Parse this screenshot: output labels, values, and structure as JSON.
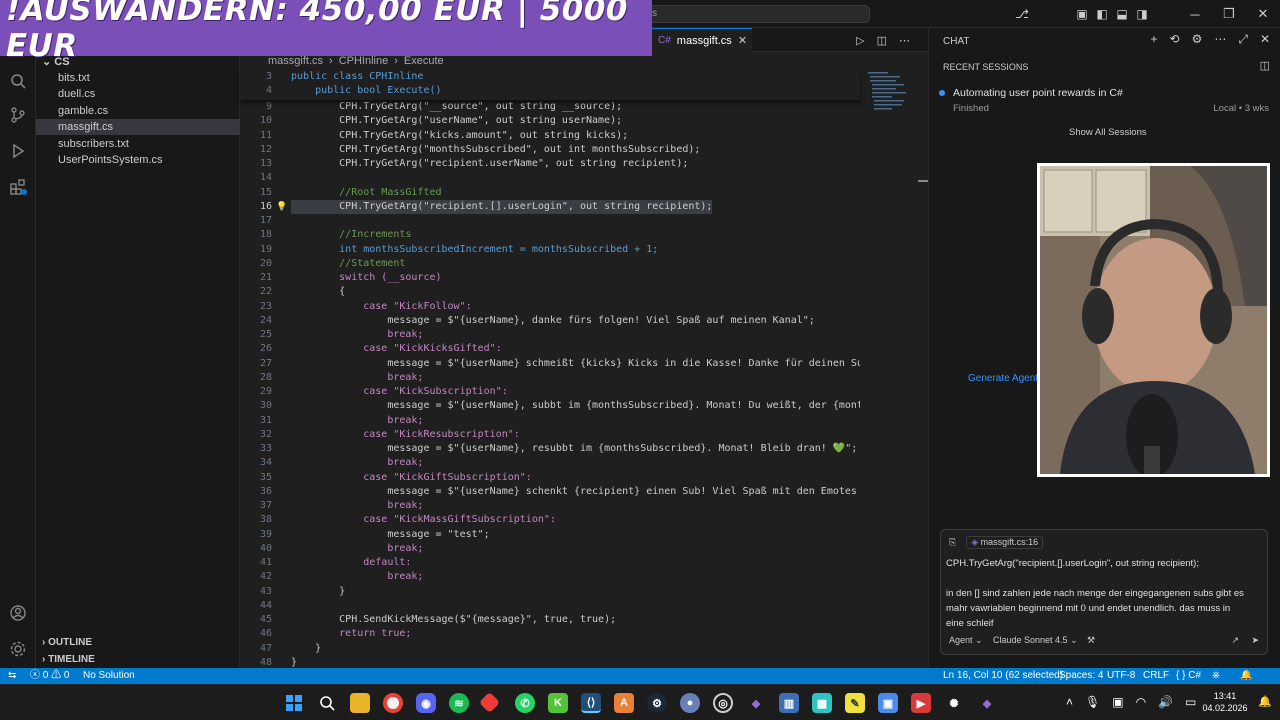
{
  "overlay_banner": "!AUSWANDERN: 450,00 EUR | 5000 EUR",
  "title_bar": {
    "search_text": "cs"
  },
  "explorer": {
    "folder": "CS",
    "files": [
      "bits.txt",
      "duell.cs",
      "gamble.cs",
      "massgift.cs",
      "subscribers.txt",
      "UserPointsSystem.cs"
    ],
    "active_file": "massgift.cs",
    "outline_label": "OUTLINE",
    "timeline_label": "TIMELINE"
  },
  "editor": {
    "tab_label": "massgift.cs",
    "breadcrumb": [
      "massgift.cs",
      "CPHInline",
      "Execute"
    ],
    "sticky_lines": [
      {
        "n": "3",
        "text": "public class CPHInline"
      },
      {
        "n": "4",
        "text": "    public bool Execute()"
      }
    ],
    "lines": [
      {
        "n": "9",
        "text": "        CPH.TryGetArg(\"__source\", out string __source);"
      },
      {
        "n": "10",
        "text": "        CPH.TryGetArg(\"userName\", out string userName);"
      },
      {
        "n": "11",
        "text": "        CPH.TryGetArg(\"kicks.amount\", out string kicks);"
      },
      {
        "n": "12",
        "text": "        CPH.TryGetArg(\"monthsSubscribed\", out int monthsSubscribed);"
      },
      {
        "n": "13",
        "text": "        CPH.TryGetArg(\"recipient.userName\", out string recipient);"
      },
      {
        "n": "14",
        "text": ""
      },
      {
        "n": "15",
        "text": "        //Root MassGifted"
      },
      {
        "n": "16",
        "text": "        CPH.TryGetArg(\"recipient.[].userLogin\", out string recipient);"
      },
      {
        "n": "17",
        "text": ""
      },
      {
        "n": "18",
        "text": "        //Increments"
      },
      {
        "n": "19",
        "text": "        int monthsSubscribedIncrement = monthsSubscribed + 1;"
      },
      {
        "n": "20",
        "text": "        //Statement"
      },
      {
        "n": "21",
        "text": "        switch (__source)"
      },
      {
        "n": "22",
        "text": "        {"
      },
      {
        "n": "23",
        "text": "            case \"KickFollow\":"
      },
      {
        "n": "24",
        "text": "                message = $\"{userName}, danke fürs folgen! Viel Spaß auf meinen Kanal\";"
      },
      {
        "n": "25",
        "text": "                break;"
      },
      {
        "n": "26",
        "text": "            case \"KickKicksGifted\":"
      },
      {
        "n": "27",
        "text": "                message = $\"{userName} schmeißt {kicks} Kicks in die Kasse! Danke für deinen Suppor"
      },
      {
        "n": "28",
        "text": "                break;"
      },
      {
        "n": "29",
        "text": "            case \"KickSubscription\":"
      },
      {
        "n": "30",
        "text": "                message = $\"{userName}, subbt im {monthsSubscribed}. Monat! Du weißt, der {monthsSu"
      },
      {
        "n": "31",
        "text": "                break;"
      },
      {
        "n": "32",
        "text": "            case \"KickResubscription\":"
      },
      {
        "n": "33",
        "text": "                message = $\"{userName}, resubbt im {monthsSubscribed}. Monat! Bleib dran! 💚\";"
      },
      {
        "n": "34",
        "text": "                break;"
      },
      {
        "n": "35",
        "text": "            case \"KickGiftSubscription\":"
      },
      {
        "n": "36",
        "text": "                message = $\"{userName} schenkt {recipient} einen Sub! Viel Spaß mit den Emotes und"
      },
      {
        "n": "37",
        "text": "                break;"
      },
      {
        "n": "38",
        "text": "            case \"KickMassGiftSubscription\":"
      },
      {
        "n": "39",
        "text": "                message = \"test\";"
      },
      {
        "n": "40",
        "text": "                break;"
      },
      {
        "n": "41",
        "text": "            default:"
      },
      {
        "n": "42",
        "text": "                break;"
      },
      {
        "n": "43",
        "text": "        }"
      },
      {
        "n": "44",
        "text": ""
      },
      {
        "n": "45",
        "text": "        CPH.SendKickMessage($\"{message}\", true, true);"
      },
      {
        "n": "46",
        "text": "        return true;"
      },
      {
        "n": "47",
        "text": "    }"
      },
      {
        "n": "48",
        "text": "}"
      }
    ]
  },
  "chat": {
    "title": "CHAT",
    "recent_sessions_label": "RECENT SESSIONS",
    "session_title": "Automating user point rewards in C#",
    "session_status": "Finished",
    "session_meta": "Local • 3 wks",
    "show_all_label": "Show All Sessions",
    "generate_agent_label": "Generate Agent",
    "context_file": "massgift.cs:16",
    "input_line1": "CPH.TryGetArg(\"recipient.[].userLogin\", out string recipient);",
    "input_line2": "in den [] sind zahlen jede nach menge der eingegangenen subs gibt es",
    "input_line3": "mahr vawriablen beginnend mit 0 und endet unendlich. das muss in",
    "input_line4": "eine schleif",
    "mode_label": "Agent",
    "model_label": "Claude Sonnet 4.5"
  },
  "status_bar": {
    "problems": "0",
    "warnings": "0",
    "solution": "No Solution",
    "position": "Ln 16, Col 10 (62 selected)",
    "spaces": "Spaces: 4",
    "encoding": "UTF-8",
    "eol": "CRLF",
    "language": "C#"
  },
  "taskbar": {
    "time": "13:41",
    "date": "04.02.2026"
  }
}
